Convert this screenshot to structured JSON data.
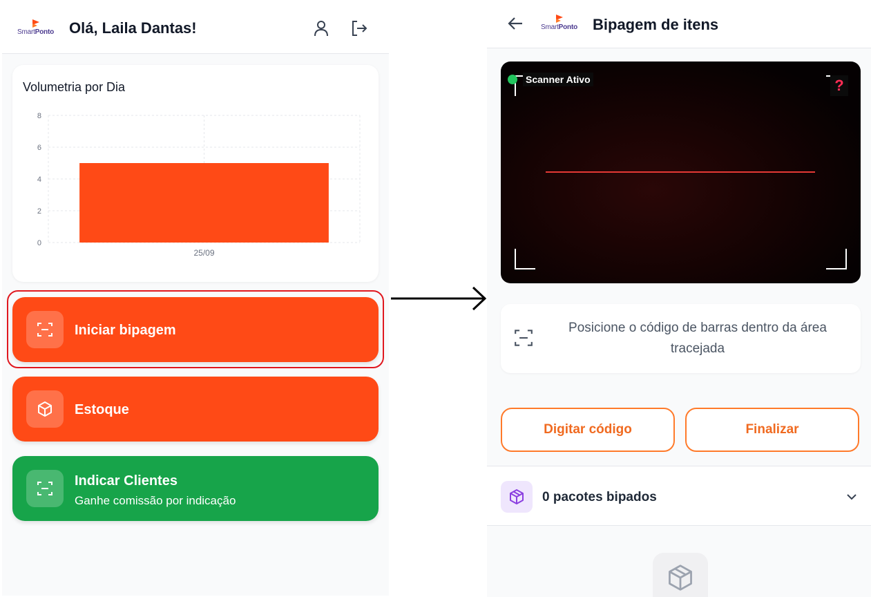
{
  "left_screen": {
    "logo": {
      "part1": "Smart",
      "part2": "Ponto"
    },
    "greeting": "Olá, Laila Dantas!",
    "header_icons": [
      "user-icon",
      "logout-icon"
    ],
    "chart_card_title": "Volumetria por Dia",
    "actions": [
      {
        "label": "Iniciar bipagem",
        "icon": "scan-icon",
        "color": "#ff4a16",
        "highlighted": true
      },
      {
        "label": "Estoque",
        "icon": "box-icon",
        "color": "#ff4a16"
      },
      {
        "label": "Indicar Clientes",
        "subtitle": "Ganhe comissão por indicação",
        "icon": "scan-icon",
        "color": "#17a44a"
      }
    ]
  },
  "chart_data": {
    "type": "bar",
    "title": "Volumetria por Dia",
    "categories": [
      "25/09"
    ],
    "values": [
      5
    ],
    "y_ticks": [
      "0",
      "2",
      "4",
      "6",
      "8"
    ],
    "ylim": [
      0,
      8
    ],
    "grid": true,
    "bar_color": "#ff4a16"
  },
  "right_screen": {
    "logo": {
      "part1": "Smart",
      "part2": "Ponto"
    },
    "title": "Bipagem de itens",
    "back_icon": "arrow-left-icon",
    "scanner_status": "Scanner Ativo",
    "help_label": "?",
    "hint_text": "Posicione o código de barras dentro da área tracejada",
    "buttons": {
      "manual": "Digitar código",
      "finish": "Finalizar"
    },
    "packages_label": "0 pacotes bipados",
    "accent_color": "#f06a20"
  },
  "colors": {
    "orange": "#ff4a16",
    "green": "#17a44a",
    "highlight": "#e0181f"
  }
}
